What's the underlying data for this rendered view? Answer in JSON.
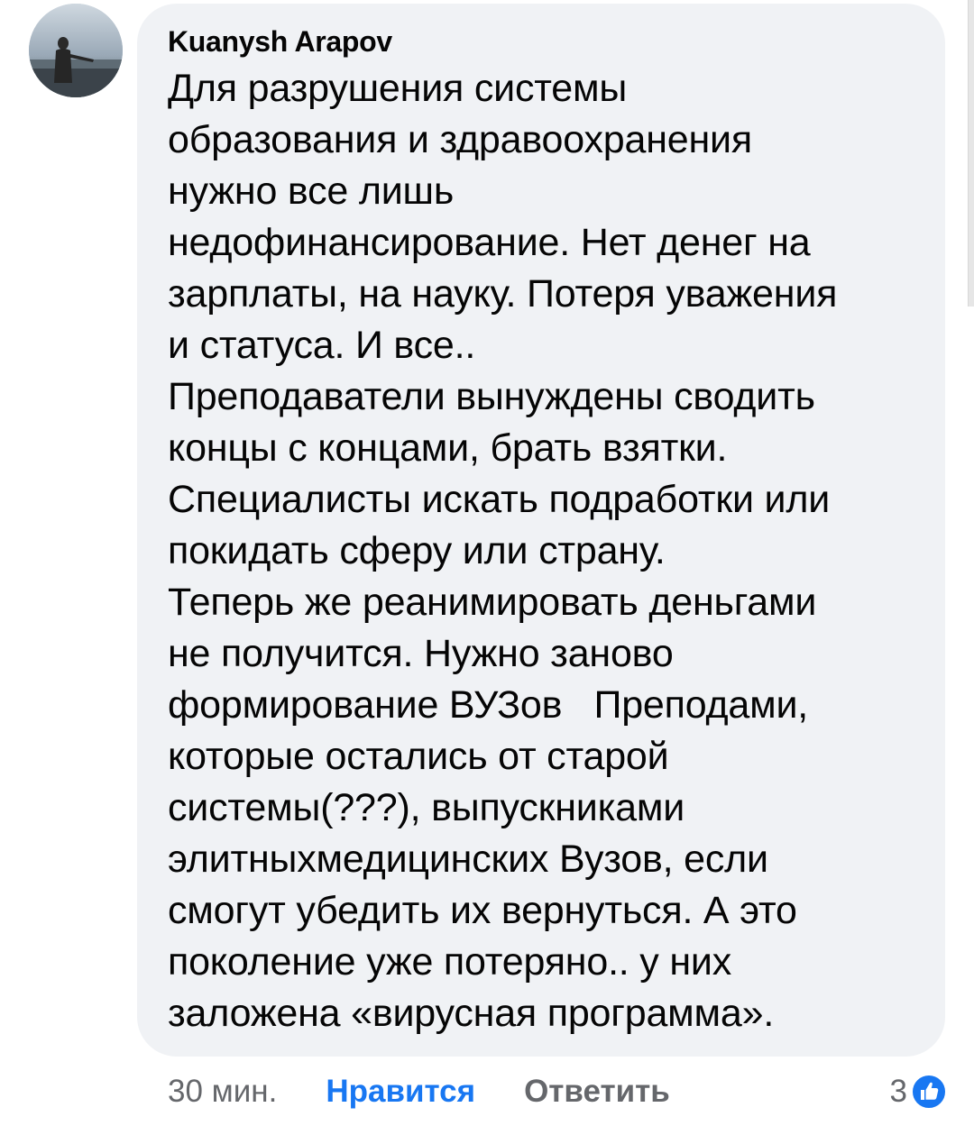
{
  "comment": {
    "author": "Kuanysh Arapov",
    "lines": [
      "Для разрушения системы",
      "образования и здравоохранения",
      "нужно все лишь",
      "недофинансирование. Нет денег на",
      "зарплаты, на науку. Потеря уважения",
      "и статуса. И все..",
      "Преподаватели вынуждены сводить",
      "концы с концами, брать взятки.",
      "Специалисты искать подработки или",
      "покидать сферу или страну.",
      "Теперь же реанимировать деньгами",
      "не получится. Нужно заново",
      "формирование ВУЗов   Преподами,",
      "которые остались от старой",
      "системы(???), выпускниками",
      "элитныхмедицинских Вузов, если",
      "смогут убедить их вернуться. А это",
      "поколение уже потеряно.. у них",
      "заложена «вирусная программа»."
    ]
  },
  "actions": {
    "time": "30 мин.",
    "like_label": "Нравится",
    "reply_label": "Ответить"
  },
  "reactions": {
    "count": "3",
    "icon": "like-reaction-icon"
  },
  "colors": {
    "bubble": "#f0f2f5",
    "text": "#050505",
    "secondary": "#65676b",
    "accent": "#1877f2"
  }
}
